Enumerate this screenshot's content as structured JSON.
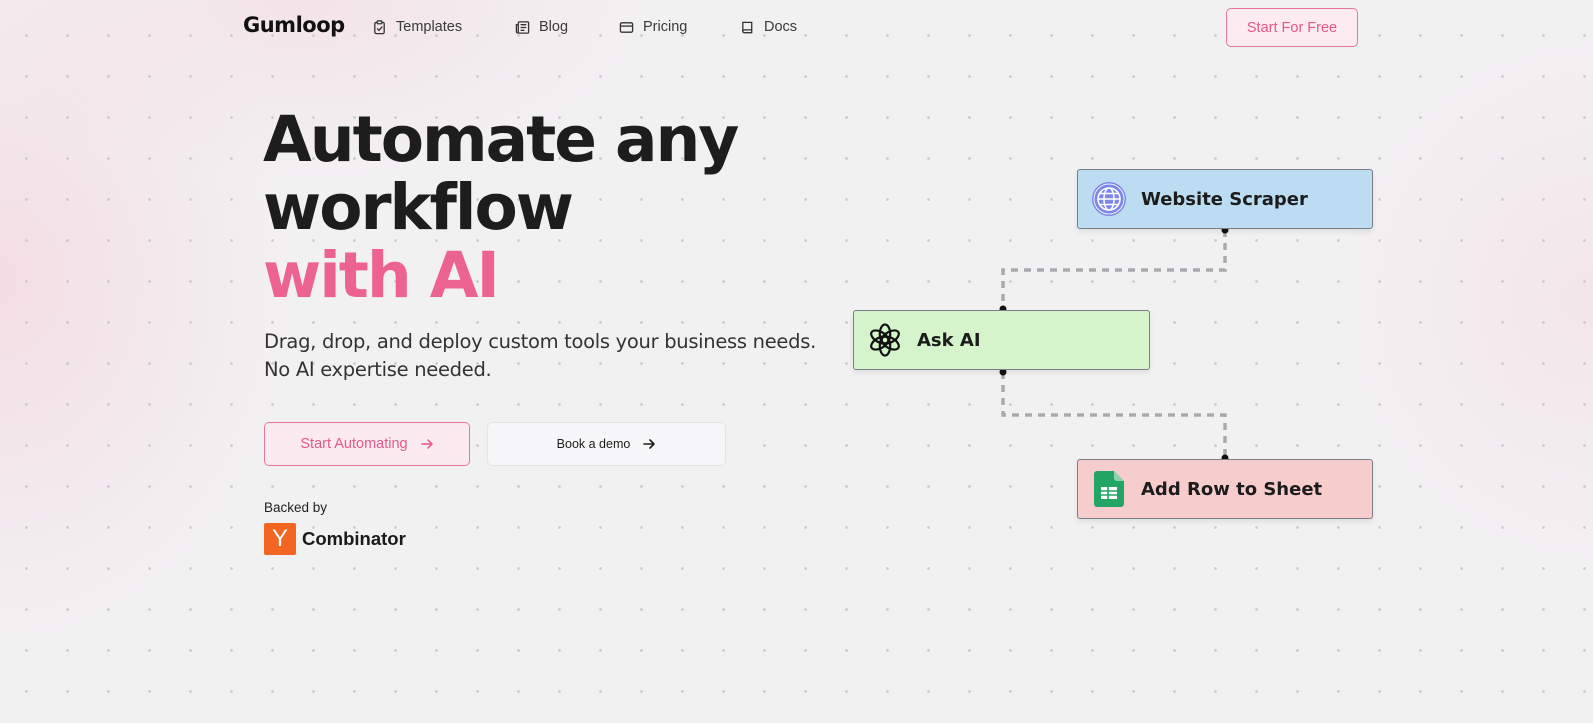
{
  "nav": {
    "logo": "Gumloop",
    "links": [
      {
        "label": "Templates",
        "icon": "clipboard-icon"
      },
      {
        "label": "Blog",
        "icon": "newspaper-icon"
      },
      {
        "label": "Pricing",
        "icon": "credit-card-icon"
      },
      {
        "label": "Docs",
        "icon": "book-icon"
      }
    ],
    "cta": "Start For Free"
  },
  "hero": {
    "line1": "Automate any",
    "line2": "workflow",
    "line3": "with AI",
    "subtitle_line1": "Drag, drop, and deploy custom tools your business needs.",
    "subtitle_line2": "No AI expertise needed.",
    "primary_button": "Start Automating",
    "secondary_button": "Book a demo",
    "backed_by": "Backed by",
    "yc_letter": "Y",
    "yc_name": "Combinator"
  },
  "flow": {
    "nodes": [
      {
        "label": "Website Scraper",
        "icon": "globe-icon",
        "color": "#bcdcf2"
      },
      {
        "label": "Ask AI",
        "icon": "openai-icon",
        "color": "#d5f4cc"
      },
      {
        "label": "Add Row to Sheet",
        "icon": "google-sheets-icon",
        "color": "#f7cccc"
      }
    ]
  },
  "colors": {
    "accent": "#ec6392",
    "accent_border": "#e7779b",
    "yc_orange": "#f26522"
  }
}
